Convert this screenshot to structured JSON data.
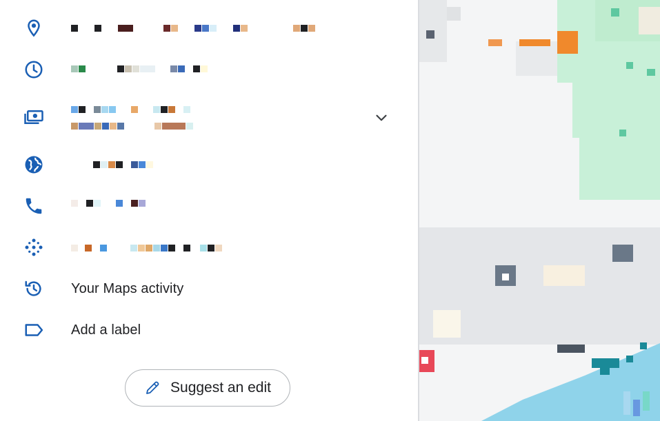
{
  "rows": [
    {
      "id": "address",
      "icon": "location-pin-icon",
      "label": ""
    },
    {
      "id": "hours",
      "icon": "clock-icon",
      "label": ""
    },
    {
      "id": "price",
      "icon": "money-icon",
      "label": ""
    },
    {
      "id": "website",
      "icon": "globe-icon",
      "label": ""
    },
    {
      "id": "phone",
      "icon": "phone-icon",
      "label": ""
    },
    {
      "id": "plus-code",
      "icon": "plus-code-icon",
      "label": ""
    },
    {
      "id": "maps-activity",
      "icon": "history-icon",
      "label": "Your Maps activity"
    },
    {
      "id": "add-label",
      "icon": "label-icon",
      "label": "Add a label"
    }
  ],
  "suggest_edit": {
    "label": "Suggest an edit",
    "icon": "pencil-icon"
  },
  "expand": {
    "icon": "chevron-down-icon"
  },
  "colors": {
    "accent_icon": "#1a5fb4",
    "text": "#202124",
    "divider": "#dadce0",
    "map_water": "#8fd3ea",
    "map_park": "#c8f0d8",
    "map_highlight": "#f0892c"
  }
}
